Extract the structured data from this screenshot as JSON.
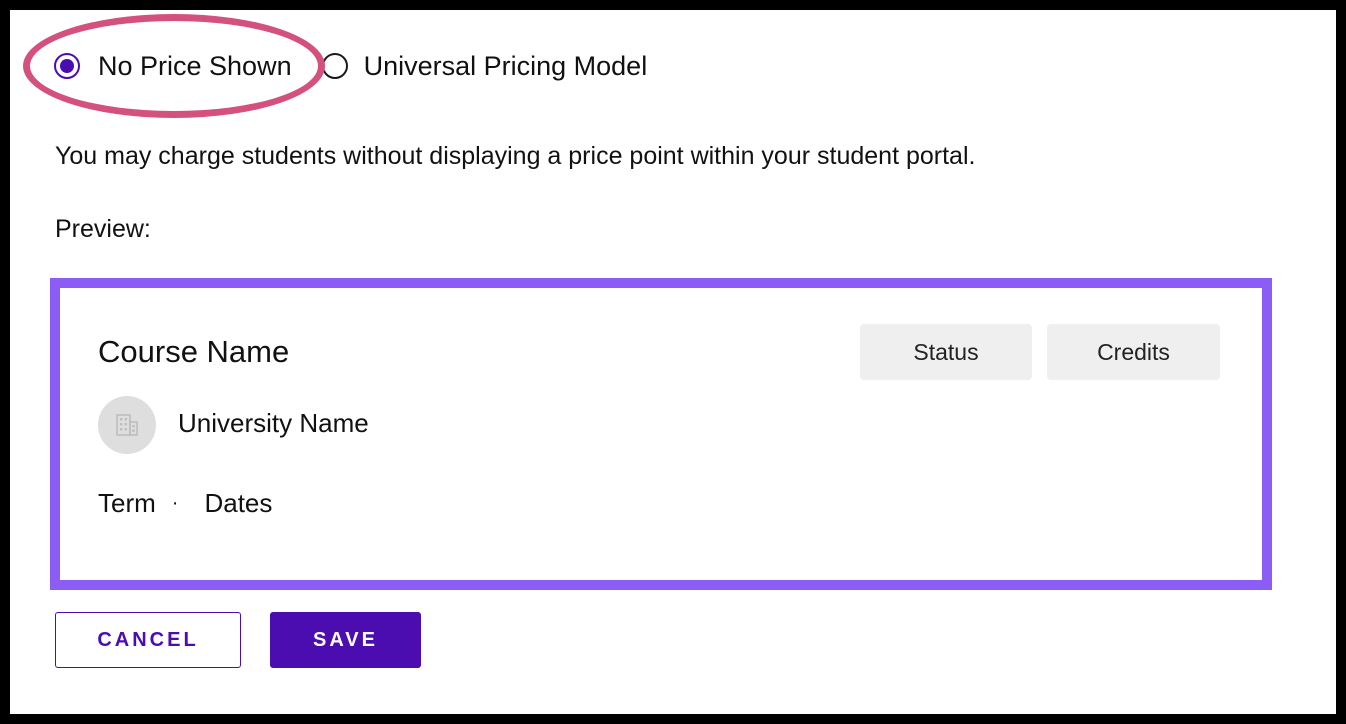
{
  "pricing_options": [
    {
      "label": "No Price Shown",
      "selected": true
    },
    {
      "label": "Universal Pricing Model",
      "selected": false
    }
  ],
  "description": "You may charge students without displaying a price point within your student portal.",
  "preview_label": "Preview:",
  "preview": {
    "course_name": "Course Name",
    "status_chip": "Status",
    "credits_chip": "Credits",
    "university_name": "University Name",
    "term": "Term",
    "separator": "·",
    "dates": "Dates"
  },
  "actions": {
    "cancel_label": "CANCEL",
    "save_label": "SAVE"
  },
  "colors": {
    "accent": "#4c0db0",
    "preview_border": "#8b5cf6",
    "highlight": "#d4507e"
  },
  "icons": {
    "university_avatar": "building-icon"
  }
}
